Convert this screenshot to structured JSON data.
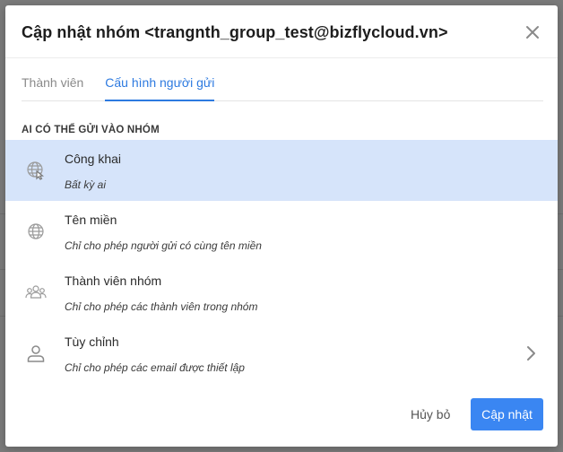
{
  "modal": {
    "title": "Cập nhật nhóm <trangnth_group_test@bizflycloud.vn>"
  },
  "tabs": [
    {
      "label": "Thành viên",
      "active": false
    },
    {
      "label": "Cấu hình người gửi",
      "active": true
    }
  ],
  "section_label": "AI CÓ THỂ GỬI VÀO NHÓM",
  "options": [
    {
      "title": "Công khai",
      "desc": "Bất kỳ ai",
      "icon": "globe-cursor-icon",
      "selected": true
    },
    {
      "title": "Tên miền",
      "desc": "Chỉ cho phép người gửi có cùng tên miền",
      "icon": "globe-icon",
      "selected": false
    },
    {
      "title": "Thành viên nhóm",
      "desc": "Chỉ cho phép các thành viên trong nhóm",
      "icon": "users-group-icon",
      "selected": false
    },
    {
      "title": "Tùy chỉnh",
      "desc": "Chỉ cho phép các email được thiết lập",
      "icon": "user-icon",
      "selected": false
    }
  ],
  "footer": {
    "cancel_label": "Hủy bỏ",
    "submit_label": "Cập nhật"
  },
  "colors": {
    "accent": "#3a86f2",
    "selected_row": "#d6e4fa",
    "tab_active": "#2d7ae0"
  }
}
